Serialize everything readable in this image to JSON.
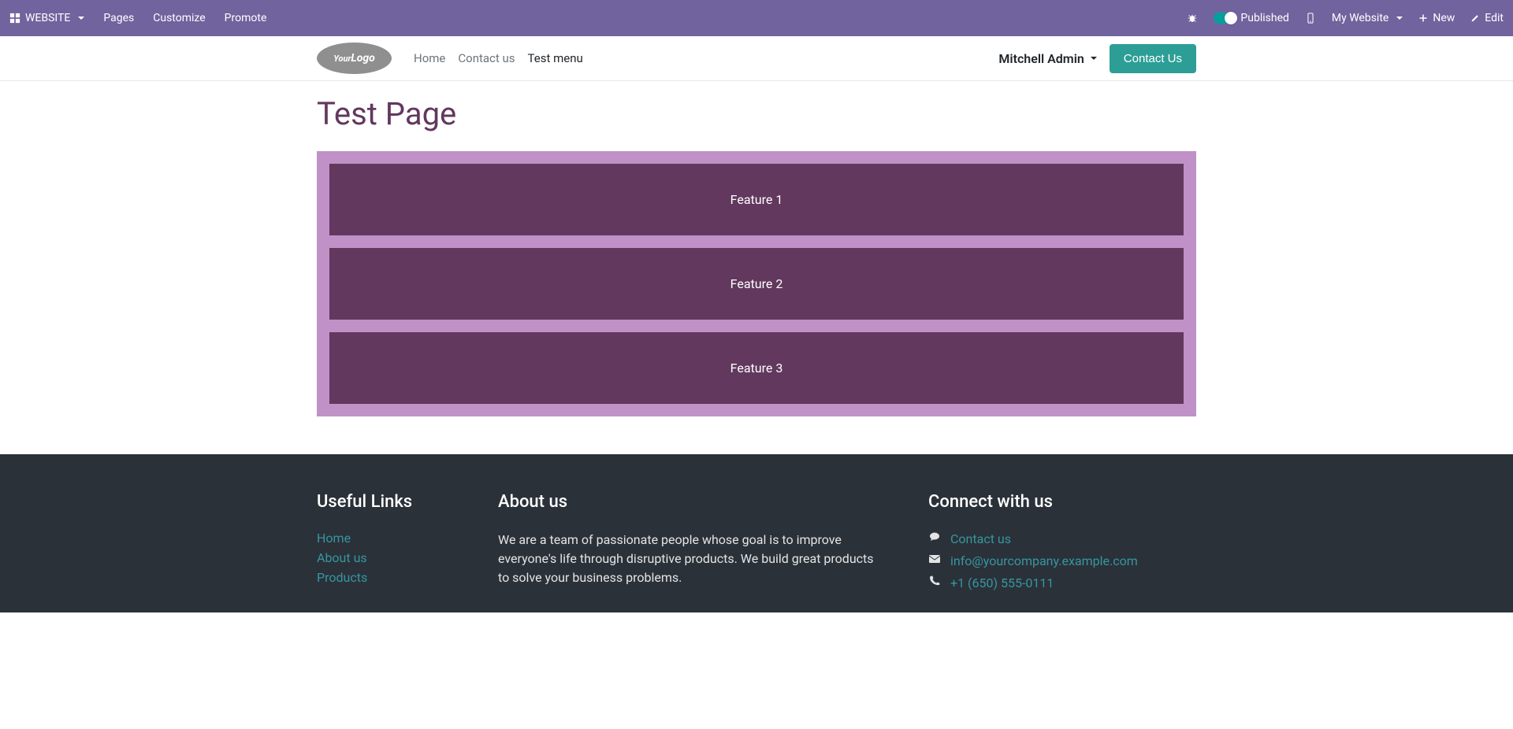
{
  "adminbar": {
    "website_label": "WEBSITE",
    "pages": "Pages",
    "customize": "Customize",
    "promote": "Promote",
    "published": "Published",
    "my_website": "My Website",
    "new": "New",
    "edit": "Edit"
  },
  "header": {
    "logo_text_a": "Your",
    "logo_text_b": "Logo",
    "nav": {
      "home": "Home",
      "contact": "Contact us",
      "test_menu": "Test menu"
    },
    "user": "Mitchell Admin",
    "contact_btn": "Contact Us"
  },
  "page": {
    "title": "Test Page",
    "features": [
      "Feature 1",
      "Feature 2",
      "Feature 3"
    ]
  },
  "footer": {
    "useful_title": "Useful Links",
    "links": {
      "home": "Home",
      "about": "About us",
      "products": "Products"
    },
    "about_title": "About us",
    "about_text": "We are a team of passionate people whose goal is to improve everyone's life through disruptive products. We build great products to solve your business problems.",
    "connect_title": "Connect with us",
    "connect": {
      "contact": "Contact us",
      "email": "info@yourcompany.example.com",
      "phone": "+1 (650) 555-0111"
    }
  }
}
